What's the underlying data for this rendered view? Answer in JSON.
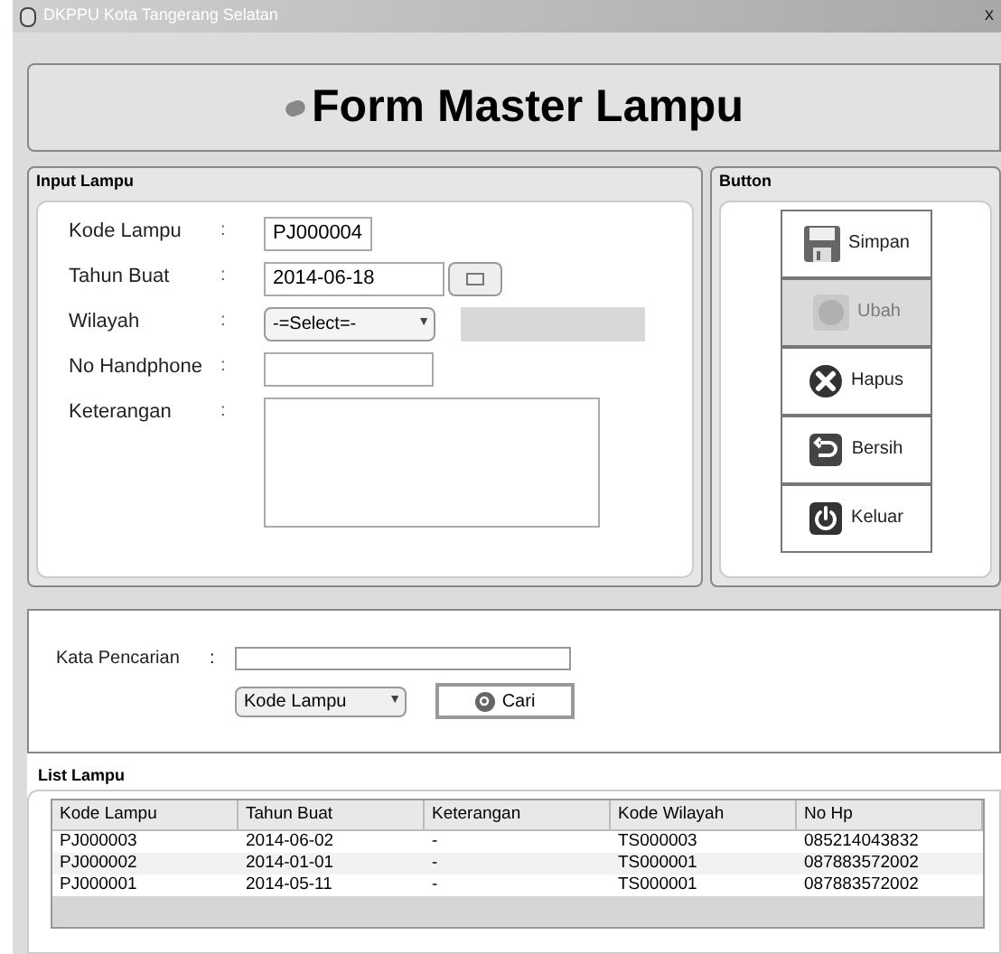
{
  "window": {
    "title": "DKPPU Kota Tangerang Selatan",
    "close": "x"
  },
  "header": {
    "title": "Form Master Lampu"
  },
  "input_panel": {
    "title": "Input Lampu",
    "fields": [
      {
        "kind": "text",
        "label": "Kode Lampu",
        "separator": ":",
        "value": "PJ000004"
      },
      {
        "kind": "date",
        "label": "Tahun Buat",
        "separator": ":",
        "value": "2014-06-18"
      },
      {
        "kind": "select",
        "label": "Wilayah",
        "separator": ":",
        "value": "-=Select=-",
        "arrow": "▼"
      },
      {
        "kind": "text",
        "label": "No Handphone",
        "separator": ":"
      },
      {
        "kind": "textarea",
        "label": "Keterangan",
        "separator": ":"
      }
    ]
  },
  "button_panel": {
    "title": "Button",
    "buttons": [
      {
        "kind": "save",
        "label": "Simpan",
        "disabled": false
      },
      {
        "kind": "edit",
        "label": "Ubah",
        "disabled": true
      },
      {
        "kind": "delete",
        "label": "Hapus",
        "disabled": false
      },
      {
        "kind": "clear",
        "label": "Bersih",
        "disabled": false
      },
      {
        "kind": "exit",
        "label": "Keluar",
        "disabled": false
      }
    ]
  },
  "search": {
    "label": "Kata Pencarian",
    "separator": ":",
    "filter": "Kode Lampu",
    "arrow": "▼",
    "button": "Cari"
  },
  "list": {
    "title": "List Lampu",
    "columns": [
      "Kode Lampu",
      "Tahun Buat",
      "Keterangan",
      "Kode Wilayah",
      "No Hp"
    ],
    "rows": [
      [
        "PJ000003",
        "2014-06-02",
        "-",
        "TS000003",
        "085214043832"
      ],
      [
        "PJ000002",
        "2014-01-01",
        "-",
        "TS000001",
        "087883572002"
      ],
      [
        "PJ000001",
        "2014-05-11",
        "-",
        "TS000001",
        "087883572002"
      ]
    ]
  }
}
